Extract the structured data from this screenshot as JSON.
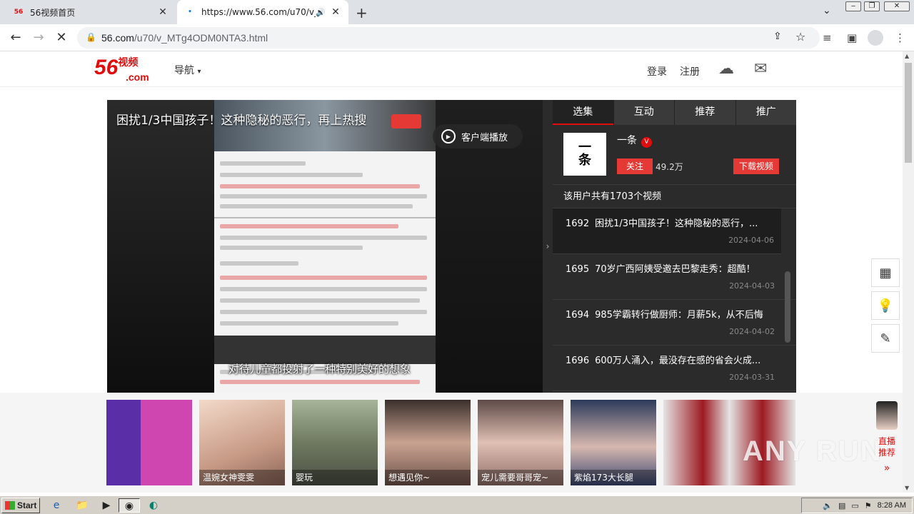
{
  "browser": {
    "tabs": [
      {
        "label": "56视频首页",
        "favicon": "56",
        "active": false
      },
      {
        "label": "https://www.56.com/u70/v_MTg",
        "active": true
      }
    ],
    "url_host": "56.com",
    "url_path": "/u70/v_MTg4ODM0NTA3.html"
  },
  "site": {
    "logo_num": "56",
    "logo_txt": "视频",
    "logo_com": ".com",
    "nav_label": "导航",
    "login": "登录",
    "register": "注册"
  },
  "player": {
    "title": "困扰1/3中国孩子！这种隐秘的恶行，再上热搜",
    "client_play": "客户端播放",
    "subtitle": "对待儿童都投射了一种特别美好的想象"
  },
  "panel": {
    "tabs": [
      "选集",
      "互动",
      "推荐",
      "推广"
    ],
    "uploader_name": "一条",
    "uploader_avatar_text": "一条",
    "follow": "关注",
    "fans": "49.2万",
    "download": "下载视频",
    "count_text": "该用户共有1703个视频",
    "items": [
      {
        "num": "1692",
        "title": "困扰1/3中国孩子！这种隐秘的恶行，...",
        "date": "2024-04-06"
      },
      {
        "num": "1695",
        "title": "70岁广西阿姨受邀去巴黎走秀：超酷！",
        "date": "2024-04-03"
      },
      {
        "num": "1694",
        "title": "985学霸转行做厨师：月薪5k，从不后悔",
        "date": "2024-04-02"
      },
      {
        "num": "1696",
        "title": "600万人涌入，最没存在感的省会火成...",
        "date": "2024-03-31"
      }
    ]
  },
  "thumbs": [
    {
      "caption": ""
    },
    {
      "caption": "温婉女神雯雯"
    },
    {
      "caption": "婴玩"
    },
    {
      "caption": "想遇见你~"
    },
    {
      "caption": "宠儿需要哥哥宠~"
    },
    {
      "caption": "紫焰173大长腿"
    },
    {
      "caption": ""
    }
  ],
  "live_side": {
    "label1": "直播",
    "label2": "推荐"
  },
  "watermark": "ANY RUN",
  "taskbar": {
    "start": "Start",
    "time": "8:28 AM"
  }
}
